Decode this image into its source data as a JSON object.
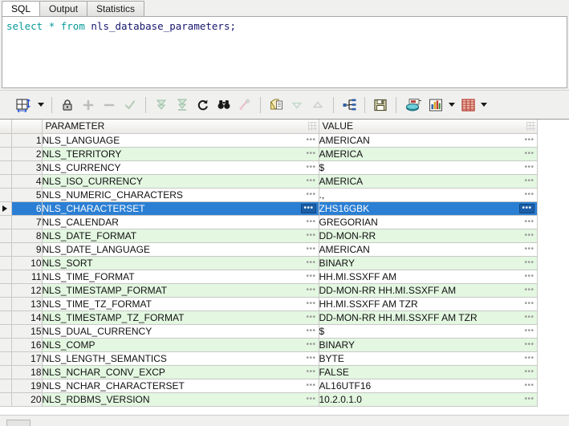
{
  "tabs": [
    {
      "label": "SQL",
      "active": true
    },
    {
      "label": "Output",
      "active": false
    },
    {
      "label": "Statistics",
      "active": false
    }
  ],
  "editor": {
    "keyword_select": "select",
    "star": "*",
    "keyword_from": "from",
    "table_name": "nls_database_parameters",
    "terminator": ";",
    "full_text": "select * from nls_database_parameters;"
  },
  "toolbar": {
    "items": [
      {
        "name": "grid-layout-button",
        "glyph": "grid",
        "enabled": true
      },
      {
        "name": "grid-layout-dropdown",
        "glyph": "caret",
        "enabled": true
      },
      {
        "name": "lock-button",
        "glyph": "lock",
        "enabled": true
      },
      {
        "name": "add-record-button",
        "glyph": "plus",
        "enabled": false
      },
      {
        "name": "delete-record-button",
        "glyph": "minus",
        "enabled": false
      },
      {
        "name": "post-changes-button",
        "glyph": "check",
        "enabled": false
      },
      {
        "name": "fetch-next-page-button",
        "glyph": "double-down",
        "enabled": false
      },
      {
        "name": "fetch-all-button",
        "glyph": "double-down-bar",
        "enabled": false
      },
      {
        "name": "refresh-button",
        "glyph": "refresh",
        "enabled": true
      },
      {
        "name": "find-button",
        "glyph": "binoculars",
        "enabled": true
      },
      {
        "name": "clear-filter-button",
        "glyph": "brush",
        "enabled": false
      },
      {
        "name": "copy-to-clipboard-button",
        "glyph": "copy",
        "enabled": true
      },
      {
        "name": "filter-down-button",
        "glyph": "triangle-down",
        "enabled": false
      },
      {
        "name": "filter-up-button",
        "glyph": "triangle-up",
        "enabled": false
      },
      {
        "name": "explain-plan-button",
        "glyph": "tree",
        "enabled": true
      },
      {
        "name": "save-button",
        "glyph": "floppy",
        "enabled": true
      },
      {
        "name": "export-data-button",
        "glyph": "export",
        "enabled": true
      },
      {
        "name": "chart-button",
        "glyph": "chart",
        "enabled": true
      },
      {
        "name": "chart-dropdown",
        "glyph": "caret",
        "enabled": true
      },
      {
        "name": "single-record-view-button",
        "glyph": "table",
        "enabled": true
      },
      {
        "name": "single-record-view-dropdown",
        "glyph": "caret",
        "enabled": true
      }
    ]
  },
  "grid": {
    "columns": [
      "PARAMETER",
      "VALUE"
    ],
    "selected_row": 6,
    "rows": [
      {
        "num": "1",
        "parameter": "NLS_LANGUAGE",
        "value": "AMERICAN"
      },
      {
        "num": "2",
        "parameter": "NLS_TERRITORY",
        "value": "AMERICA"
      },
      {
        "num": "3",
        "parameter": "NLS_CURRENCY",
        "value": "$"
      },
      {
        "num": "4",
        "parameter": "NLS_ISO_CURRENCY",
        "value": "AMERICA"
      },
      {
        "num": "5",
        "parameter": "NLS_NUMERIC_CHARACTERS",
        "value": ".,"
      },
      {
        "num": "6",
        "parameter": "NLS_CHARACTERSET",
        "value": "ZHS16GBK"
      },
      {
        "num": "7",
        "parameter": "NLS_CALENDAR",
        "value": "GREGORIAN"
      },
      {
        "num": "8",
        "parameter": "NLS_DATE_FORMAT",
        "value": "DD-MON-RR"
      },
      {
        "num": "9",
        "parameter": "NLS_DATE_LANGUAGE",
        "value": "AMERICAN"
      },
      {
        "num": "10",
        "parameter": "NLS_SORT",
        "value": "BINARY"
      },
      {
        "num": "11",
        "parameter": "NLS_TIME_FORMAT",
        "value": "HH.MI.SSXFF AM"
      },
      {
        "num": "12",
        "parameter": "NLS_TIMESTAMP_FORMAT",
        "value": "DD-MON-RR HH.MI.SSXFF AM"
      },
      {
        "num": "13",
        "parameter": "NLS_TIME_TZ_FORMAT",
        "value": "HH.MI.SSXFF AM TZR"
      },
      {
        "num": "14",
        "parameter": "NLS_TIMESTAMP_TZ_FORMAT",
        "value": "DD-MON-RR HH.MI.SSXFF AM TZR"
      },
      {
        "num": "15",
        "parameter": "NLS_DUAL_CURRENCY",
        "value": "$"
      },
      {
        "num": "16",
        "parameter": "NLS_COMP",
        "value": "BINARY"
      },
      {
        "num": "17",
        "parameter": "NLS_LENGTH_SEMANTICS",
        "value": "BYTE"
      },
      {
        "num": "18",
        "parameter": "NLS_NCHAR_CONV_EXCP",
        "value": "FALSE"
      },
      {
        "num": "19",
        "parameter": "NLS_NCHAR_CHARACTERSET",
        "value": "AL16UTF16"
      },
      {
        "num": "20",
        "parameter": "NLS_RDBMS_VERSION",
        "value": "10.2.0.1.0"
      }
    ]
  },
  "colors": {
    "selection_blue": "#2a7fd4",
    "alt_row_green": "#e3f7e1",
    "chrome_gray": "#f0f0ef",
    "keyword_teal": "#0a9a9a",
    "identifier_navy": "#16166e"
  }
}
